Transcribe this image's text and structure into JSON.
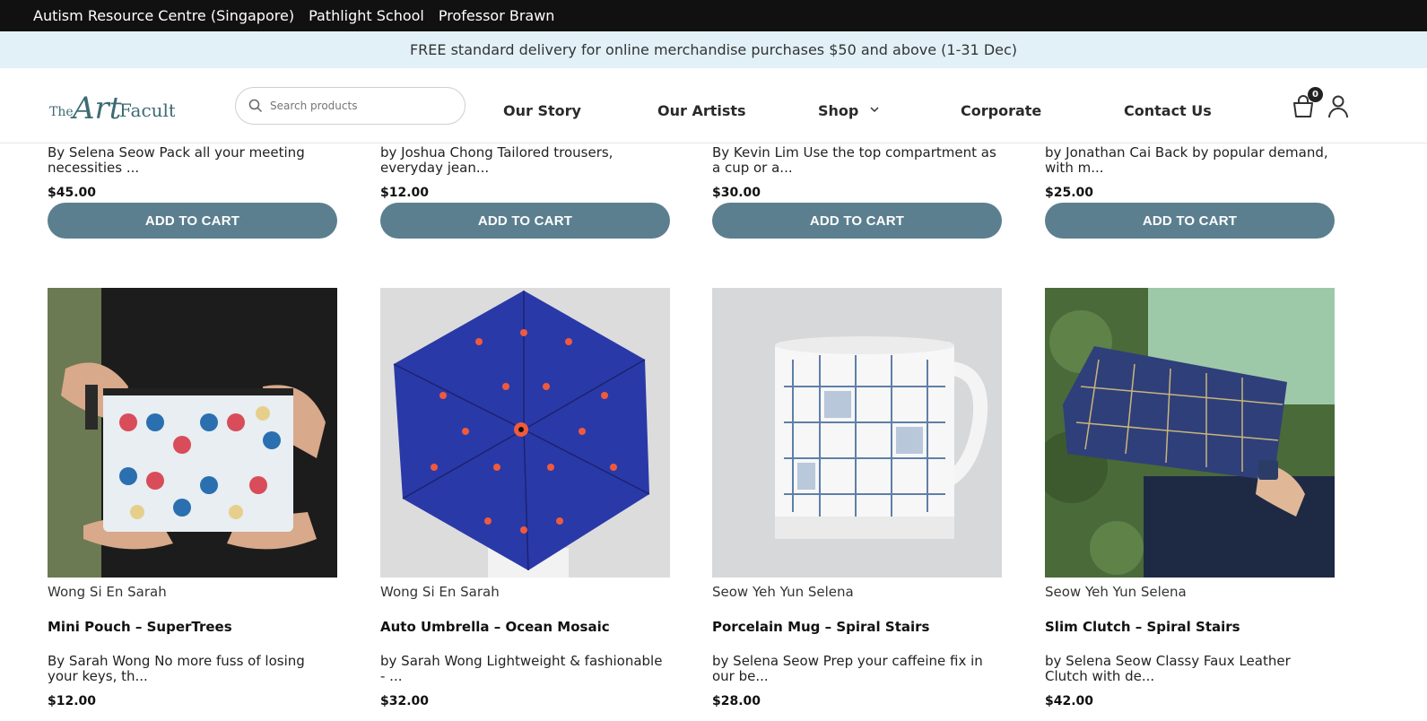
{
  "topbar": {
    "links": [
      "Autism Resource Centre (Singapore)",
      "Pathlight School",
      "Professor Brawn"
    ]
  },
  "promo": {
    "text": "FREE standard delivery for online merchandise purchases $50 and above (1-31 Dec)"
  },
  "header": {
    "logo_text": "TheArtFaculty",
    "search_placeholder": "Search products",
    "nav": [
      "Our Story",
      "Our Artists",
      "Shop",
      "Corporate",
      "Contact Us"
    ],
    "cart_count": "0"
  },
  "colors": {
    "accent": "#5b7f8f",
    "topbar": "#111111",
    "promo_bg": "#e2f1f8",
    "logo": "#3d6b73"
  },
  "row1": [
    {
      "desc": "By Selena Seow Pack all your meeting necessities ...",
      "price": "$45.00",
      "button": "ADD TO CART"
    },
    {
      "desc": "by Joshua Chong  Tailored trousers, everyday jean...",
      "price": "$12.00",
      "button": "ADD TO CART"
    },
    {
      "desc": "By Kevin Lim Use the top compartment as a cup or a...",
      "price": "$30.00",
      "button": "ADD TO CART"
    },
    {
      "desc": "by Jonathan Cai   Back by popular demand, with m...",
      "price": "$25.00",
      "button": "ADD TO CART"
    }
  ],
  "row2": [
    {
      "vendor": "Wong Si En Sarah",
      "name": "Mini Pouch – SuperTrees",
      "desc": "By Sarah Wong No more fuss of losing your keys, th...",
      "price": "$12.00",
      "image": "pouch-photo"
    },
    {
      "vendor": "Wong Si En Sarah",
      "name": "Auto Umbrella – Ocean Mosaic",
      "desc": "by Sarah Wong  Lightweight & fashionable - ...",
      "price": "$32.00",
      "image": "umbrella-photo"
    },
    {
      "vendor": "Seow Yeh Yun Selena",
      "name": "Porcelain Mug – Spiral Stairs",
      "desc": "by Selena Seow  Prep your caffeine fix in our be...",
      "price": "$28.00",
      "image": "mug-photo"
    },
    {
      "vendor": "Seow Yeh Yun Selena",
      "name": "Slim Clutch – Spiral Stairs",
      "desc": "by Selena Seow Classy Faux Leather Clutch with de...",
      "price": "$42.00",
      "image": "clutch-photo"
    }
  ]
}
